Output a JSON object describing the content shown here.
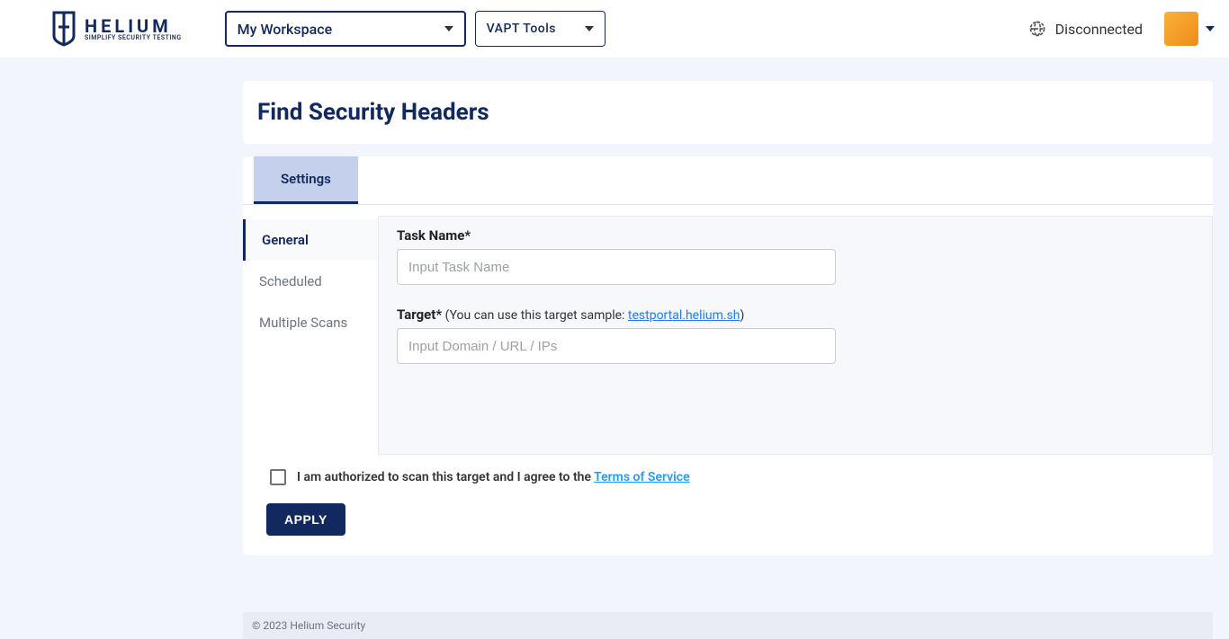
{
  "header": {
    "logo_title": "HELIUM",
    "logo_sub": "SIMPLIFY SECURITY TESTING",
    "workspace_selected": "My Workspace",
    "tools_label": "VAPT Tools",
    "status_text": "Disconnected"
  },
  "page": {
    "title": "Find Security Headers"
  },
  "tabs": {
    "settings": "Settings"
  },
  "sidenav": {
    "general": "General",
    "scheduled": "Scheduled",
    "multiple": "Multiple Scans"
  },
  "form": {
    "task_label": "Task Name*",
    "task_placeholder": "Input Task Name",
    "target_label": "Target*",
    "target_hint_prefix": " (You can use this target sample: ",
    "target_hint_link": "testportal.helium.sh",
    "target_hint_suffix": ")",
    "target_placeholder": "Input Domain / URL / IPs"
  },
  "consent": {
    "text": "I am authorized to scan this target and I agree to the ",
    "tos": "Terms of Service"
  },
  "actions": {
    "apply": "APPLY"
  },
  "footer": {
    "copyright": "© 2023 Helium Security"
  }
}
